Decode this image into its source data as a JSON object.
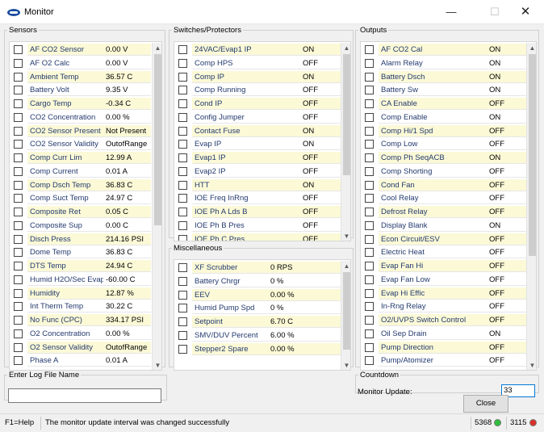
{
  "window": {
    "title": "Monitor",
    "minimize": "—",
    "maximize": "☐",
    "close": "✕"
  },
  "colors": {
    "highlight": "#fbf9d6",
    "label": "#233a6e",
    "status_green": "#2fbf3a",
    "status_red": "#d9302a"
  },
  "sensors": {
    "legend": "Sensors",
    "rows": [
      {
        "name": "AF CO2 Sensor",
        "value": "0.00 V",
        "hl": true
      },
      {
        "name": "AF O2 Calc",
        "value": "0.00 V",
        "hl": false
      },
      {
        "name": "Ambient Temp",
        "value": "36.57 C",
        "hl": true
      },
      {
        "name": "Battery Volt",
        "value": "9.35 V",
        "hl": false
      },
      {
        "name": "Cargo Temp",
        "value": "-0.34 C",
        "hl": true
      },
      {
        "name": "CO2 Concentration",
        "value": "0.00 %",
        "hl": false
      },
      {
        "name": "CO2 Sensor Present",
        "value": "Not Present",
        "hl": true
      },
      {
        "name": "CO2 Sensor Validity",
        "value": "OutofRange",
        "hl": false
      },
      {
        "name": "Comp Curr Lim",
        "value": "12.99 A",
        "hl": true
      },
      {
        "name": "Comp Current",
        "value": "0.01 A",
        "hl": false
      },
      {
        "name": "Comp Dsch Temp",
        "value": "36.83 C",
        "hl": true
      },
      {
        "name": "Comp Suct Temp",
        "value": "24.97 C",
        "hl": false
      },
      {
        "name": "Composite Ret",
        "value": "0.05 C",
        "hl": true
      },
      {
        "name": "Composite Sup",
        "value": "0.00 C",
        "hl": false
      },
      {
        "name": "Disch Press",
        "value": "214.16 PSI",
        "hl": true
      },
      {
        "name": "Dome Temp",
        "value": "36.83 C",
        "hl": false
      },
      {
        "name": "DTS Temp",
        "value": "24.94 C",
        "hl": true
      },
      {
        "name": "Humid H2O/Sec Evap",
        "value": "-60.00 C",
        "hl": false
      },
      {
        "name": "Humidity",
        "value": "12.87 %",
        "hl": true
      },
      {
        "name": "Int Therm Temp",
        "value": "30.22 C",
        "hl": false
      },
      {
        "name": "No Func (CPC)",
        "value": "334.17 PSI",
        "hl": true
      },
      {
        "name": "O2 Concentration",
        "value": "0.00 %",
        "hl": false
      },
      {
        "name": "O2 Sensor Validity",
        "value": "OutofRange",
        "hl": true
      },
      {
        "name": "Phase A",
        "value": "0.01 A",
        "hl": false
      }
    ]
  },
  "switches": {
    "legend": "Switches/Protectors",
    "rows": [
      {
        "name": "24VAC/Evap1 IP",
        "value": "ON",
        "hl": true
      },
      {
        "name": "Comp HPS",
        "value": "OFF",
        "hl": false
      },
      {
        "name": "Comp IP",
        "value": "ON",
        "hl": true
      },
      {
        "name": "Comp Running",
        "value": "OFF",
        "hl": false
      },
      {
        "name": "Cond IP",
        "value": "OFF",
        "hl": true
      },
      {
        "name": "Config Jumper",
        "value": "OFF",
        "hl": false
      },
      {
        "name": "Contact Fuse",
        "value": "ON",
        "hl": true
      },
      {
        "name": "Evap IP",
        "value": "ON",
        "hl": false
      },
      {
        "name": "Evap1 IP",
        "value": "OFF",
        "hl": true
      },
      {
        "name": "Evap2 IP",
        "value": "OFF",
        "hl": false
      },
      {
        "name": "HTT",
        "value": "ON",
        "hl": true
      },
      {
        "name": "IOE Freq InRng",
        "value": "OFF",
        "hl": false
      },
      {
        "name": "IOE Ph A Lds B",
        "value": "OFF",
        "hl": true
      },
      {
        "name": "IOE Ph B Pres",
        "value": "OFF",
        "hl": false
      },
      {
        "name": "IOE Ph C Pres",
        "value": "OFF",
        "hl": true
      }
    ]
  },
  "misc": {
    "legend": "Miscellaneous",
    "rows": [
      {
        "name": "XF Scrubber",
        "value": "0 RPS",
        "hl": true
      },
      {
        "name": "Battery Chrgr",
        "value": "0 %",
        "hl": false
      },
      {
        "name": "EEV",
        "value": "0.00 %",
        "hl": true
      },
      {
        "name": "Humid Pump Spd",
        "value": "0 %",
        "hl": false
      },
      {
        "name": "Setpoint",
        "value": "6.70 C",
        "hl": true
      },
      {
        "name": "SMV/DUV Percent",
        "value": "6.00 %",
        "hl": false
      },
      {
        "name": "Stepper2 Spare",
        "value": "0.00 %",
        "hl": true
      }
    ]
  },
  "outputs": {
    "legend": "Outputs",
    "rows": [
      {
        "name": "AF CO2 Cal",
        "value": "ON",
        "hl": true
      },
      {
        "name": "Alarm Relay",
        "value": "ON",
        "hl": false
      },
      {
        "name": "Battery Dsch",
        "value": "ON",
        "hl": true
      },
      {
        "name": "Battery Sw",
        "value": "ON",
        "hl": false
      },
      {
        "name": "CA Enable",
        "value": "OFF",
        "hl": true
      },
      {
        "name": "Comp Enable",
        "value": "ON",
        "hl": false
      },
      {
        "name": "Comp Hi/1 Spd",
        "value": "OFF",
        "hl": true
      },
      {
        "name": "Comp Low",
        "value": "OFF",
        "hl": false
      },
      {
        "name": "Comp Ph SeqACB",
        "value": "ON",
        "hl": true
      },
      {
        "name": "Comp Shorting",
        "value": "OFF",
        "hl": false
      },
      {
        "name": "Cond Fan",
        "value": "OFF",
        "hl": true
      },
      {
        "name": "Cool Relay",
        "value": "OFF",
        "hl": false
      },
      {
        "name": "Defrost Relay",
        "value": "OFF",
        "hl": true
      },
      {
        "name": "Display Blank",
        "value": "ON",
        "hl": false
      },
      {
        "name": "Econ Circuit/ESV",
        "value": "OFF",
        "hl": true
      },
      {
        "name": "Electric Heat",
        "value": "OFF",
        "hl": false
      },
      {
        "name": "Evap Fan Hi",
        "value": "OFF",
        "hl": true
      },
      {
        "name": "Evap Fan Low",
        "value": "OFF",
        "hl": false
      },
      {
        "name": "Evap Hi Effic",
        "value": "OFF",
        "hl": true
      },
      {
        "name": "In-Rng Relay",
        "value": "OFF",
        "hl": false
      },
      {
        "name": "O2/UVPS Switch Control",
        "value": "OFF",
        "hl": true
      },
      {
        "name": "Oil Sep Drain",
        "value": "ON",
        "hl": false
      },
      {
        "name": "Pump Direction",
        "value": "OFF",
        "hl": true
      },
      {
        "name": "Pump/Atomizer",
        "value": "OFF",
        "hl": false
      }
    ]
  },
  "log": {
    "legend": "Enter Log File Name",
    "value": ""
  },
  "countdown": {
    "legend": "Countdown",
    "label": "Monitor Update:",
    "value": "33"
  },
  "close_button": "Close",
  "status": {
    "help": "F1=Help",
    "message": "The monitor update interval was changed successfully",
    "count_green": "5368",
    "count_red": "3115"
  }
}
